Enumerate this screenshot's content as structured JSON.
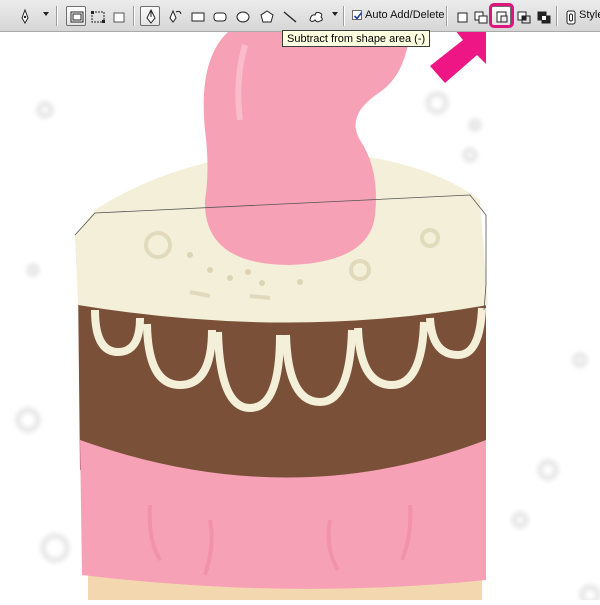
{
  "toolbar": {
    "auto_add_delete": {
      "label": "Auto Add/Delete",
      "checked": true
    },
    "style_label": "Style",
    "tools": [
      "pen-tool-preset-icon",
      "shape-layers-icon",
      "paths-icon",
      "fill-pixels-icon",
      "pen-icon",
      "freeform-pen-icon",
      "rectangle-icon",
      "rounded-rectangle-icon",
      "ellipse-icon",
      "polygon-icon",
      "line-icon",
      "custom-shape-icon",
      "create-new-shape-area-icon",
      "add-to-shape-area-icon",
      "subtract-from-shape-area-icon",
      "intersect-shape-areas-icon",
      "exclude-overlapping-shape-areas-icon",
      "link-icon"
    ],
    "highlight_color": "#e0137f"
  },
  "tooltip": {
    "text": "Subtract from shape area (-)"
  },
  "colors": {
    "frosting": "#f4efd9",
    "chocolate": "#7a5038",
    "pink": "#f7a1b6",
    "sponge": "#f3d7ae",
    "arrow": "#ee1585"
  }
}
